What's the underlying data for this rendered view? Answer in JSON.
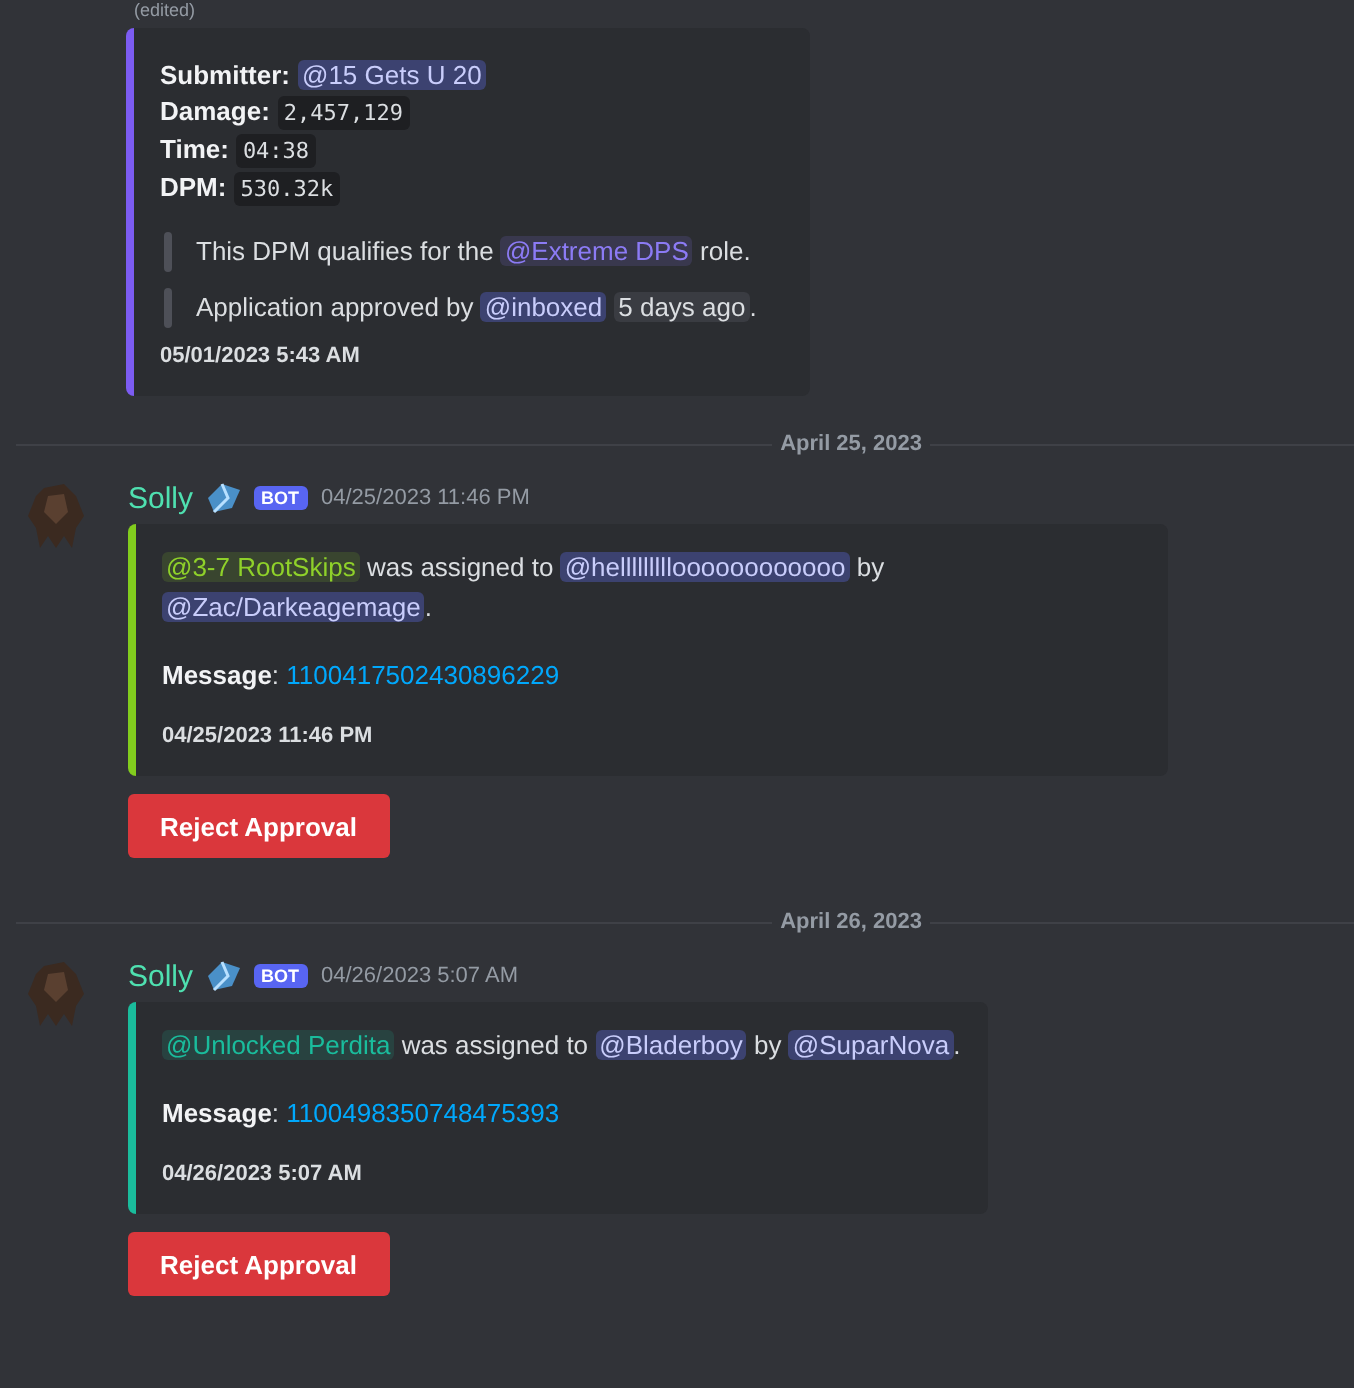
{
  "top_note": "(edited)",
  "messages": [
    {
      "kind": "continuation",
      "embed": {
        "color": "#7c5cf2",
        "blocks": [
          {
            "kind": "lines",
            "lines": [
              [
                {
                  "kind": "bold",
                  "text": "Submitter:"
                },
                {
                  "kind": "mention",
                  "text": "@15 Gets U 20"
                }
              ],
              [
                {
                  "kind": "bold",
                  "text": "Damage:"
                },
                {
                  "kind": "code",
                  "text": "2,457,129"
                }
              ],
              [
                {
                  "kind": "bold",
                  "text": "Time:"
                },
                {
                  "kind": "code",
                  "text": "04:38"
                }
              ],
              [
                {
                  "kind": "bold",
                  "text": "DPM:"
                },
                {
                  "kind": "code",
                  "text": "530.32k"
                }
              ]
            ]
          },
          {
            "kind": "quote",
            "segments": [
              {
                "kind": "text",
                "text": "This DPM qualifies for the "
              },
              {
                "kind": "role",
                "text": "@Extreme DPS",
                "color": "#8c7bf5"
              },
              {
                "kind": "text",
                "text": " role."
              }
            ]
          },
          {
            "kind": "quote",
            "segments": [
              {
                "kind": "text",
                "text": "Application approved by "
              },
              {
                "kind": "mention",
                "text": "@inboxed"
              },
              {
                "kind": "time",
                "text": "5 days ago"
              },
              {
                "kind": "text",
                "text": "."
              }
            ]
          }
        ],
        "footer": "05/01/2023 5:43 AM"
      }
    },
    {
      "kind": "divider",
      "text": "April 25, 2023"
    },
    {
      "kind": "bot",
      "author": "Solly",
      "badge": "BOT",
      "time": "04/25/2023 11:46 PM",
      "embed": {
        "color": "#82cc1e",
        "blocks": [
          {
            "kind": "para",
            "segments": [
              {
                "kind": "role",
                "text": "@3-7 RootSkips",
                "color": "#8fd12a"
              },
              {
                "kind": "text",
                "text": " was assigned to "
              },
              {
                "kind": "mention",
                "text": "@hellllllllloooooooooooo"
              },
              {
                "kind": "text",
                "text": " by "
              },
              {
                "kind": "mention",
                "text": "@Zac/Darkeagemage"
              },
              {
                "kind": "text",
                "text": "."
              }
            ]
          },
          {
            "kind": "para",
            "segments": [
              {
                "kind": "bold",
                "text": "Message"
              },
              {
                "kind": "text",
                "text": ": "
              },
              {
                "kind": "link",
                "text": "1100417502430896229"
              }
            ]
          }
        ],
        "footer": "04/25/2023 11:46 PM"
      },
      "button": "Reject Approval"
    },
    {
      "kind": "divider",
      "text": "April 26, 2023"
    },
    {
      "kind": "bot",
      "author": "Solly",
      "badge": "BOT",
      "time": "04/26/2023 5:07 AM",
      "embed": {
        "color": "#1abc9c",
        "blocks": [
          {
            "kind": "para",
            "segments": [
              {
                "kind": "role",
                "text": "@Unlocked Perdita",
                "color": "#1abc9c"
              },
              {
                "kind": "text",
                "text": " was assigned to "
              },
              {
                "kind": "mention",
                "text": "@Bladerboy"
              },
              {
                "kind": "text",
                "text": " by "
              },
              {
                "kind": "mention",
                "text": "@SuparNova"
              },
              {
                "kind": "text",
                "text": "."
              }
            ]
          },
          {
            "kind": "para",
            "segments": [
              {
                "kind": "bold",
                "text": "Message"
              },
              {
                "kind": "text",
                "text": ": "
              },
              {
                "kind": "link",
                "text": "1100498350748475393"
              }
            ]
          }
        ],
        "footer": "04/26/2023 5:07 AM"
      },
      "button": "Reject Approval"
    }
  ]
}
